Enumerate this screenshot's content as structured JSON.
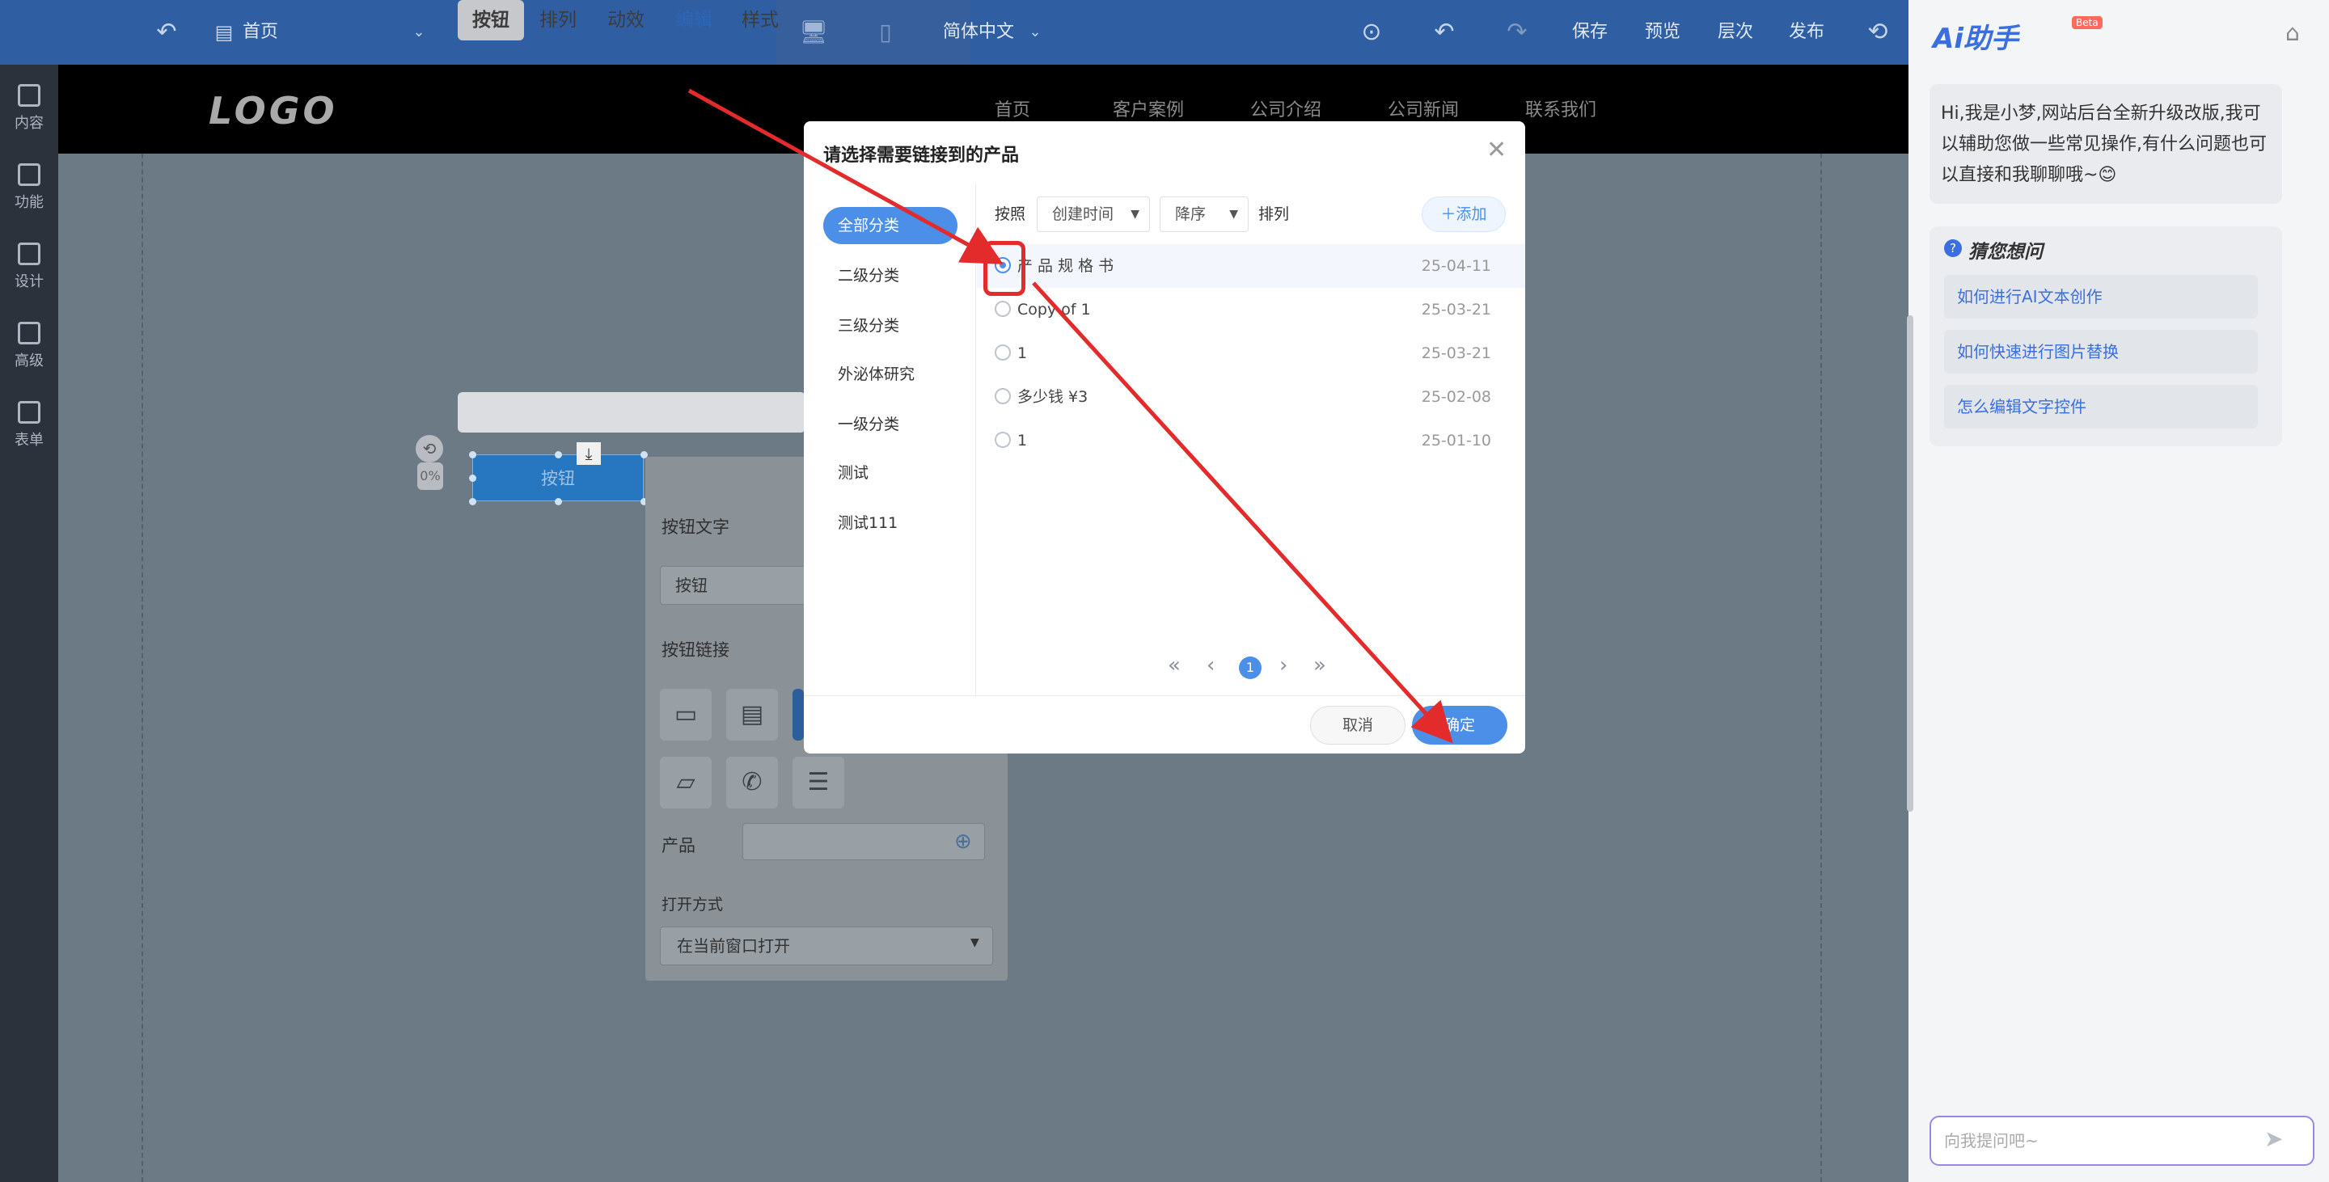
{
  "topbar": {
    "page_name": "首页",
    "language": "简体中文",
    "save_label": "保存",
    "preview_label": "预览",
    "layers_label": "层次",
    "publish_label": "发布",
    "icons": [
      "back-icon",
      "page-icon",
      "chevron-down-icon",
      "desktop-icon",
      "mobile-icon",
      "more-icon",
      "undo-icon",
      "redo-icon",
      "history-icon"
    ]
  },
  "leftrail": {
    "items": [
      {
        "label": "内容"
      },
      {
        "label": "功能"
      },
      {
        "label": "设计"
      },
      {
        "label": "高级"
      },
      {
        "label": "表单"
      }
    ]
  },
  "site": {
    "logo": "LOGO",
    "nav": [
      "首页",
      "客户案例",
      "公司介绍",
      "公司新闻",
      "联系我们"
    ]
  },
  "floatbar": {
    "items": [
      "按钮",
      "排列",
      "动效",
      "编辑",
      "样式"
    ],
    "active": "按钮",
    "highlight": "编辑"
  },
  "selected_button": {
    "label": "按钮",
    "percent": "0%"
  },
  "panel": {
    "button_text_label": "按钮文字",
    "button_text_value": "按钮",
    "button_link_label": "按钮链接",
    "product_label": "产品",
    "open_mode_label": "打开方式",
    "open_mode_value": "在当前窗口打开"
  },
  "modal": {
    "title": "请选择需要链接到的产品",
    "categories": [
      "全部分类",
      "二级分类",
      "三级分类",
      "外泌体研究",
      "一级分类",
      "测试",
      "测试111"
    ],
    "active_category": "全部分类",
    "sort_prefix": "按照",
    "sort_field": "创建时间",
    "sort_order": "降序",
    "sort_suffix": "排列",
    "add_label": "添加",
    "products": [
      {
        "name": "产 品 规 格 书",
        "date": "25-04-11",
        "selected": true
      },
      {
        "name": "Copy of 1",
        "date": "25-03-21",
        "selected": false
      },
      {
        "name": "1",
        "date": "25-03-21",
        "selected": false
      },
      {
        "name": "多少钱 ¥3",
        "date": "25-02-08",
        "selected": false
      },
      {
        "name": "1",
        "date": "25-01-10",
        "selected": false
      }
    ],
    "current_page": "1",
    "cancel_label": "取消",
    "ok_label": "确定"
  },
  "ai": {
    "title": "Ai助手",
    "badge": "Beta",
    "greeting": "Hi,我是小梦,网站后台全新升级改版,我可以辅助您做一些常见操作,有什么问题也可以直接和我聊聊哦~😊",
    "guess_title": "猜您想问",
    "questions": [
      "如何进行AI文本创作",
      "如何快速进行图片替换",
      "怎么编辑文字控件"
    ],
    "input_placeholder": "向我提问吧~"
  },
  "colors": {
    "brand_blue": "#2f5ea3",
    "accent": "#4b8fe8",
    "annotation_red": "#e32b2b"
  }
}
